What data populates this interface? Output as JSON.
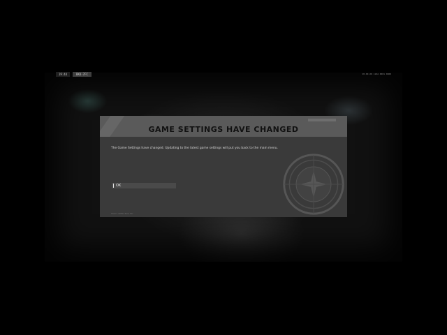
{
  "hud": {
    "time": "19:44",
    "ping": "BKU-7FC",
    "version": "V0.00.08 1102.0001 0000"
  },
  "dialog": {
    "title": "GAME SETTINGS HAVE CHANGED",
    "message": "The Game Settings have changed. Updating to the latest game settings will put you back to the main menu.",
    "ok_label": "OK",
    "footer_hint": "SELECT ENTER  BACK ESC"
  },
  "colors": {
    "background": "#000000",
    "dialog_bg": "#3a3a3a",
    "header_bg": "#5a5a5a",
    "title_text": "#111111",
    "body_text": "#d8d8d8"
  },
  "icons": {
    "emblem": "faction-emblem-icon",
    "ok_marker": "selection-marker-icon"
  }
}
